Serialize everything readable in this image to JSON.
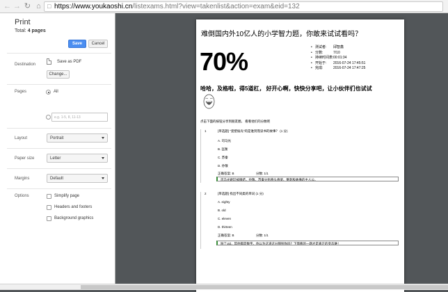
{
  "browser": {
    "url_host": "https://www.youkaoshi.cn",
    "url_path": "/listexams.html?view=takenlist&action=exam&eid=132"
  },
  "print": {
    "title": "Print",
    "total_label": "Total: ",
    "total_pages": "4 pages",
    "save_label": "Save",
    "cancel_label": "Cancel",
    "destination_label": "Destination",
    "destination_value": "Save as PDF",
    "change_label": "Change...",
    "pages_label": "Pages",
    "pages_all": "All",
    "pages_placeholder": "e.g. 1-5, 8, 11-13",
    "layout_label": "Layout",
    "layout_value": "Portrait",
    "paper_label": "Paper size",
    "paper_value": "Letter",
    "margins_label": "Margins",
    "margins_value": "Default",
    "options_label": "Options",
    "options": [
      "Simplify page",
      "Headers and footers",
      "Background graphics"
    ]
  },
  "page": {
    "title": "难倒国内外10亿人的小学智力题，你敢来试试看吗？",
    "score": "70%",
    "info": [
      {
        "k": "测试者:",
        "v": "邱智鑫"
      },
      {
        "k": "分数:",
        "v": "7/10"
      },
      {
        "k": "持续时间表:",
        "v": "00:01:34"
      },
      {
        "k": "开始于:",
        "v": "2016-07-24 17:45:51"
      },
      {
        "k": "完成:",
        "v": "2016-07-24 17:47:25"
      }
    ],
    "headline": "哈哈，及格啦，得5道杠， 好开心啊，快快分享吧，让小伙伴们也试试",
    "share_text": "点击下面的按钮分享到朋友圈， 看看他们的分数吧",
    "questions": [
      {
        "num": "1",
        "text": "[单选题] \"瓷壁偷光\"的是谁到而读书的故事？ (1 分)",
        "options": [
          "A. 司马光",
          "B. 匡衡",
          "C. 苏秦",
          "D. 孙敬"
        ],
        "answer": "正确答案: B",
        "score": "分数: 1/1",
        "explain": "司马光砸缸被眼结，孙敬、苏秦分别悬头悬梁、锥刺股故事的主人公。"
      },
      {
        "num": "2",
        "text": "[单选题] 找出不同类的单词 (1 分)",
        "options": [
          "A. eighty",
          "B. old",
          "C. eleven",
          "D. thirteen"
        ],
        "answer": "正确答案: B",
        "score": "分数: 1/1",
        "explain": "除了old，其他都是数字。你以为这道这分猜别你吗？下面看的一题才是真正的变态难！"
      }
    ]
  }
}
